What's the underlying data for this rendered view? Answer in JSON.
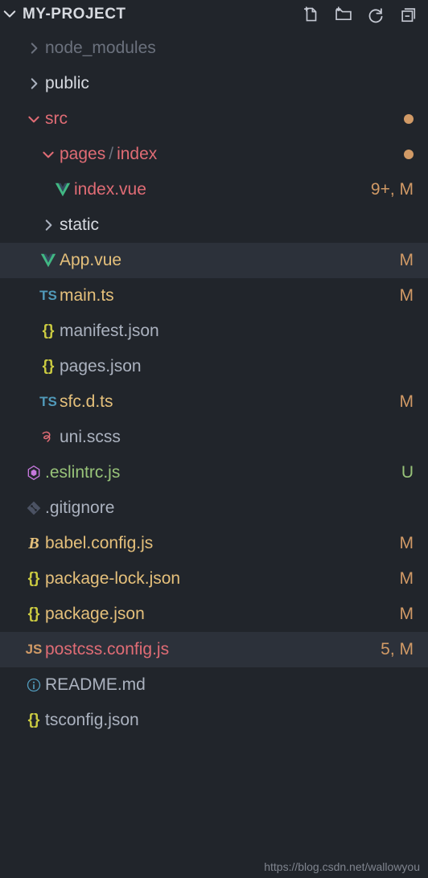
{
  "header": {
    "title": "MY-PROJECT"
  },
  "tree": {
    "node_modules": "node_modules",
    "public": "public",
    "src": "src",
    "pages": "pages",
    "pages_sep": "/",
    "index_folder": "index",
    "index_vue": "index.vue",
    "index_vue_status": "9+, M",
    "static": "static",
    "app_vue": "App.vue",
    "app_vue_status": "M",
    "main_ts": "main.ts",
    "main_ts_status": "M",
    "manifest_json": "manifest.json",
    "pages_json": "pages.json",
    "sfc_dts": "sfc.d.ts",
    "sfc_dts_status": "M",
    "uni_scss": "uni.scss",
    "eslintrc": ".eslintrc.js",
    "eslintrc_status": "U",
    "gitignore": ".gitignore",
    "babel_config": "babel.config.js",
    "babel_config_status": "M",
    "package_lock": "package-lock.json",
    "package_lock_status": "M",
    "package_json": "package.json",
    "package_json_status": "M",
    "postcss_config": "postcss.config.js",
    "postcss_config_status": "5, M",
    "readme": "README.md",
    "tsconfig": "tsconfig.json"
  },
  "footer": {
    "url": "https://blog.csdn.net/wallowyou"
  }
}
